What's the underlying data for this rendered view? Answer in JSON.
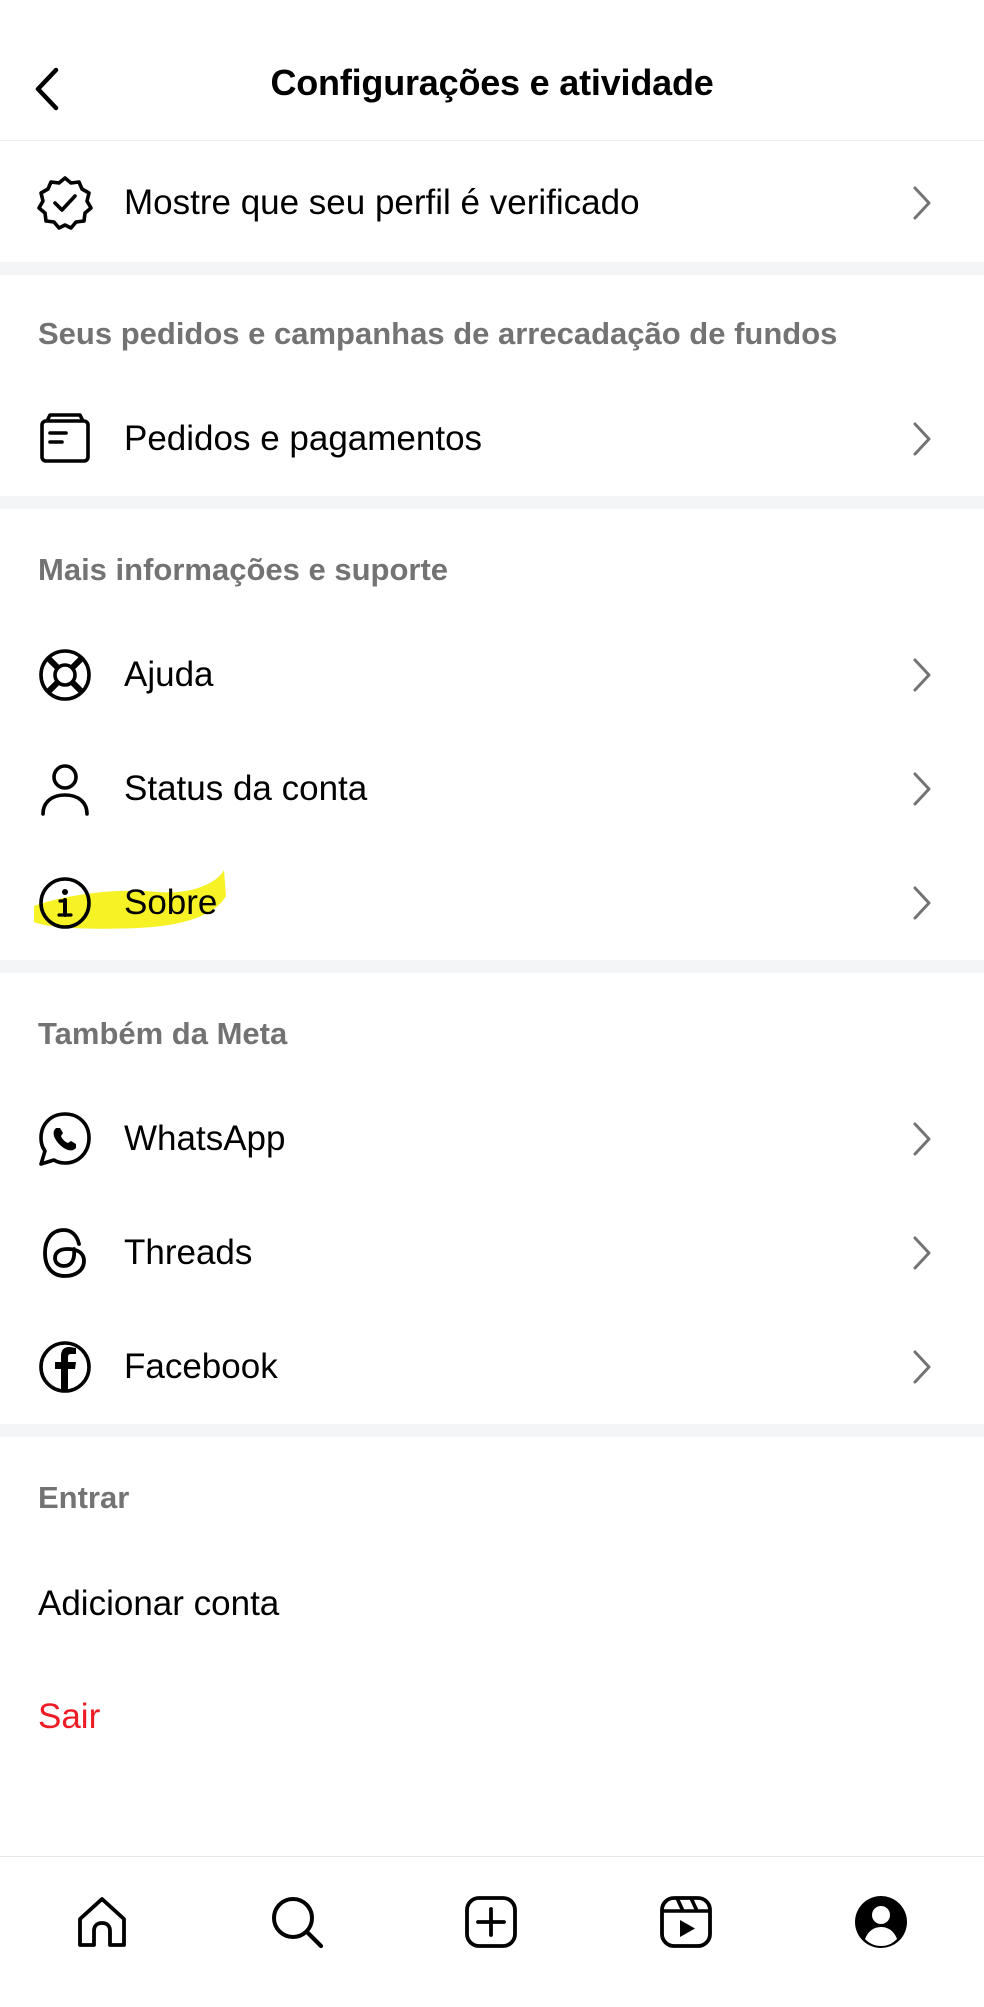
{
  "header": {
    "title": "Configurações e atividade"
  },
  "verified": {
    "label": "Mostre que seu perfil é verificado",
    "icon": "verified-badge-icon"
  },
  "orders_section": {
    "title": "Seus pedidos e campanhas de arrecadação de fundos",
    "items": [
      {
        "label": "Pedidos e pagamentos",
        "icon": "orders-icon"
      }
    ]
  },
  "support_section": {
    "title": "Mais informações e suporte",
    "items": [
      {
        "label": "Ajuda",
        "icon": "lifebuoy-icon"
      },
      {
        "label": "Status da conta",
        "icon": "person-icon"
      },
      {
        "label": "Sobre",
        "icon": "info-icon",
        "highlighted": true
      }
    ]
  },
  "meta_section": {
    "title": "Também da Meta",
    "items": [
      {
        "label": "WhatsApp",
        "icon": "whatsapp-icon"
      },
      {
        "label": "Threads",
        "icon": "threads-icon"
      },
      {
        "label": "Facebook",
        "icon": "facebook-icon"
      }
    ]
  },
  "login_section": {
    "title": "Entrar",
    "add_account": "Adicionar conta",
    "logout": "Sair"
  },
  "tabbar": [
    "home-icon",
    "search-icon",
    "create-icon",
    "reels-icon",
    "profile-icon"
  ],
  "colors": {
    "highlight": "#f4f000",
    "logout": "#ed1c24",
    "section_text": "#737373",
    "divider": "#f4f5f7"
  }
}
